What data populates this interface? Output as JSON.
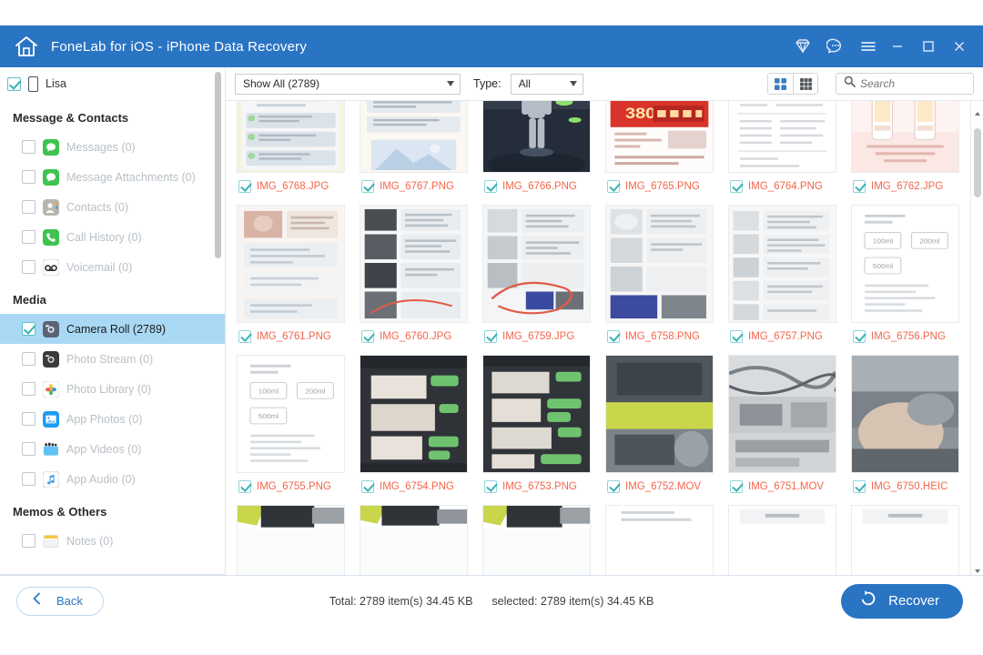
{
  "window": {
    "title": "FoneLab for iOS - iPhone Data Recovery",
    "home_icon": "home-icon",
    "titlebar_color": "#2a74c4",
    "icons": [
      {
        "name": "premium-diamond-icon"
      },
      {
        "name": "feedback-chat-icon"
      },
      {
        "name": "menu-hamburger-icon"
      }
    ],
    "controls": [
      {
        "name": "minimize-button",
        "label": "minimize"
      },
      {
        "name": "maximize-button",
        "label": "maximize"
      },
      {
        "name": "close-button",
        "label": "close"
      }
    ]
  },
  "sidebar": {
    "device": {
      "name": "Lisa",
      "checked": true,
      "icon": "iphone-icon"
    },
    "groups": [
      {
        "title": "Message & Contacts",
        "items": [
          {
            "label": "Messages (0)",
            "icon": "messages-icon",
            "checked": false,
            "selected": false,
            "icon_color": "#3fc34f"
          },
          {
            "label": "Message Attachments (0)",
            "icon": "message-attachments-icon",
            "checked": false,
            "selected": false,
            "icon_color": "#3fc34f"
          },
          {
            "label": "Contacts (0)",
            "icon": "contacts-icon",
            "checked": false,
            "selected": false,
            "icon_color": "#9b9b93"
          },
          {
            "label": "Call History (0)",
            "icon": "call-history-icon",
            "checked": false,
            "selected": false,
            "icon_color": "#3fc34f"
          },
          {
            "label": "Voicemail (0)",
            "icon": "voicemail-icon",
            "checked": false,
            "selected": false,
            "icon_color": "#ffffff"
          }
        ]
      },
      {
        "title": "Media",
        "items": [
          {
            "label": "Camera Roll (2789)",
            "icon": "camera-roll-icon",
            "checked": true,
            "selected": true,
            "icon_color": "#5a6475"
          },
          {
            "label": "Photo Stream (0)",
            "icon": "photo-stream-icon",
            "checked": false,
            "selected": false,
            "icon_color": "#3b3b3b"
          },
          {
            "label": "Photo Library (0)",
            "icon": "photo-library-icon",
            "checked": false,
            "selected": false,
            "icon_color": "#ffffff"
          },
          {
            "label": "App Photos (0)",
            "icon": "app-photos-icon",
            "checked": false,
            "selected": false,
            "icon_color": "#1f9bf0"
          },
          {
            "label": "App Videos (0)",
            "icon": "app-videos-icon",
            "checked": false,
            "selected": false,
            "icon_color": "#5ec3f2"
          },
          {
            "label": "App Audio (0)",
            "icon": "app-audio-icon",
            "checked": false,
            "selected": false,
            "icon_color": "#ffffff"
          }
        ]
      },
      {
        "title": "Memos & Others",
        "items": [
          {
            "label": "Notes (0)",
            "icon": "notes-icon",
            "checked": false,
            "selected": false,
            "icon_color": "#f5c842"
          }
        ]
      }
    ]
  },
  "toolbar": {
    "show_all": {
      "value": "Show All (2789)",
      "icon": "chevron-down-icon"
    },
    "type_label": "Type:",
    "type_value": "All",
    "view_toggle": [
      {
        "name": "large-grid-view",
        "active": true
      },
      {
        "name": "small-grid-view",
        "active": false
      }
    ],
    "search": {
      "placeholder": "Search",
      "value": "",
      "icon": "search-icon"
    }
  },
  "grid": {
    "items": [
      {
        "name": "IMG_6768.JPG",
        "checked": true,
        "thumb": "anime-lockscreen"
      },
      {
        "name": "IMG_6767.PNG",
        "checked": true,
        "thumb": "chat-screenshot"
      },
      {
        "name": "IMG_6766.PNG",
        "checked": true,
        "thumb": "game-character"
      },
      {
        "name": "IMG_6765.PNG",
        "checked": true,
        "thumb": "shopping-ad"
      },
      {
        "name": "IMG_6764.PNG",
        "checked": true,
        "thumb": "document-page"
      },
      {
        "name": "IMG_6762.JPG",
        "checked": true,
        "thumb": "product-bottles"
      },
      {
        "name": "IMG_6761.PNG",
        "checked": true,
        "thumb": "photo-collage"
      },
      {
        "name": "IMG_6760.JPG",
        "checked": true,
        "thumb": "chat-with-photos"
      },
      {
        "name": "IMG_6759.JPG",
        "checked": true,
        "thumb": "chat-annotated"
      },
      {
        "name": "IMG_6758.PNG",
        "checked": true,
        "thumb": "chat-thread"
      },
      {
        "name": "IMG_6757.PNG",
        "checked": true,
        "thumb": "chat-list"
      },
      {
        "name": "IMG_6756.PNG",
        "checked": true,
        "thumb": "form-document"
      },
      {
        "name": "IMG_6755.PNG",
        "checked": true,
        "thumb": "form-document-2"
      },
      {
        "name": "IMG_6754.PNG",
        "checked": true,
        "thumb": "dark-chat"
      },
      {
        "name": "IMG_6753.PNG",
        "checked": true,
        "thumb": "dark-chat-2"
      },
      {
        "name": "IMG_6752.MOV",
        "checked": true,
        "thumb": "video-desk"
      },
      {
        "name": "IMG_6751.MOV",
        "checked": true,
        "thumb": "video-wires"
      },
      {
        "name": "IMG_6750.HEIC",
        "checked": true,
        "thumb": "photo-person"
      },
      {
        "name": "",
        "checked": false,
        "thumb": "partial-green-black"
      },
      {
        "name": "",
        "checked": false,
        "thumb": "partial-green-black"
      },
      {
        "name": "",
        "checked": false,
        "thumb": "partial-green-black"
      },
      {
        "name": "",
        "checked": false,
        "thumb": "partial-doc"
      },
      {
        "name": "",
        "checked": false,
        "thumb": "partial-doc"
      },
      {
        "name": "",
        "checked": false,
        "thumb": "partial-doc"
      }
    ]
  },
  "footer": {
    "back_label": "Back",
    "back_icon": "chevron-left-icon",
    "status_total": "Total: 2789 item(s) 34.45 KB",
    "status_selected": "selected: 2789 item(s) 34.45 KB",
    "recover_label": "Recover",
    "recover_icon": "restore-icon",
    "recover_color": "#2a74c4"
  }
}
